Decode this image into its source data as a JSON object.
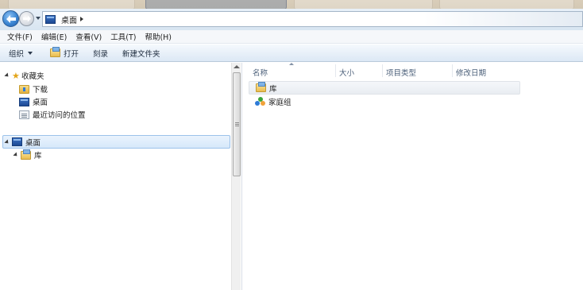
{
  "address": {
    "crumb": "桌面"
  },
  "menubar": [
    {
      "label": "文件(F)"
    },
    {
      "label": "编辑(E)"
    },
    {
      "label": "查看(V)"
    },
    {
      "label": "工具(T)"
    },
    {
      "label": "帮助(H)"
    }
  ],
  "toolbar": {
    "organize": "组织",
    "open": "打开",
    "burn": "刻录",
    "new_folder": "新建文件夹"
  },
  "tree": {
    "favorites": "收藏夹",
    "downloads": "下载",
    "desktop_fav": "桌面",
    "recent": "最近访问的位置",
    "desktop": "桌面",
    "libraries": "库"
  },
  "columns": {
    "name": "名称",
    "size": "大小",
    "type": "项目类型",
    "modified": "修改日期"
  },
  "files": [
    {
      "name": "库",
      "icon": "library-icon"
    },
    {
      "name": "家庭组",
      "icon": "homegroup-icon"
    }
  ],
  "colors": {
    "selection": "#d6e8fa",
    "selection_border": "#9cc2ea",
    "toolbar_bg": "#dce8f5",
    "header_text": "#4c607a"
  }
}
